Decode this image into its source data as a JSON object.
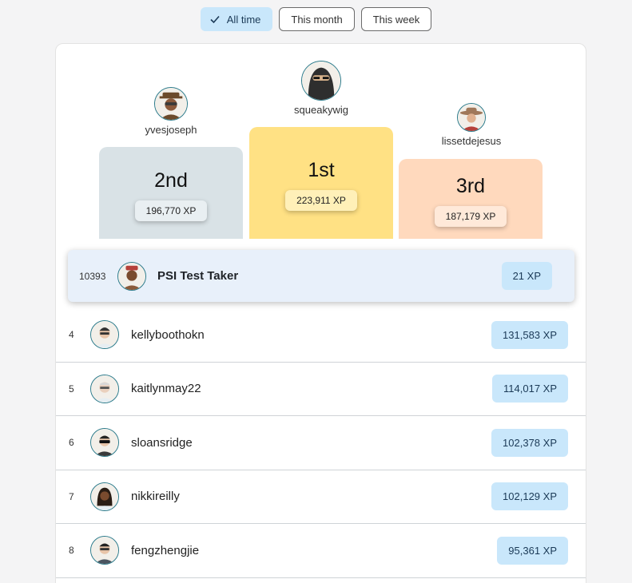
{
  "filters": [
    {
      "label": "All time",
      "active": true
    },
    {
      "label": "This month",
      "active": false
    },
    {
      "label": "This week",
      "active": false
    }
  ],
  "podium": {
    "first": {
      "name": "squeakywig",
      "place": "1st",
      "xp": "223,911 XP"
    },
    "second": {
      "name": "yvesjoseph",
      "place": "2nd",
      "xp": "196,770 XP"
    },
    "third": {
      "name": "lissetdejesus",
      "place": "3rd",
      "xp": "187,179 XP"
    }
  },
  "current_user": {
    "rank": "10393",
    "name": "PSI Test Taker",
    "xp": "21 XP"
  },
  "leaderboard": [
    {
      "rank": "4",
      "name": "kellyboothokn",
      "xp": "131,583 XP"
    },
    {
      "rank": "5",
      "name": "kaitlynmay22",
      "xp": "114,017 XP"
    },
    {
      "rank": "6",
      "name": "sloansridge",
      "xp": "102,378 XP"
    },
    {
      "rank": "7",
      "name": "nikkireilly",
      "xp": "102,129 XP"
    },
    {
      "rank": "8",
      "name": "fengzhengjie",
      "xp": "95,361 XP"
    }
  ],
  "colors": {
    "accent_pill": "#c9e7fb",
    "gold": "#ffe184",
    "silver": "#d9e2e6",
    "bronze": "#ffd9bd",
    "current_user_row": "#e8f0fa"
  }
}
